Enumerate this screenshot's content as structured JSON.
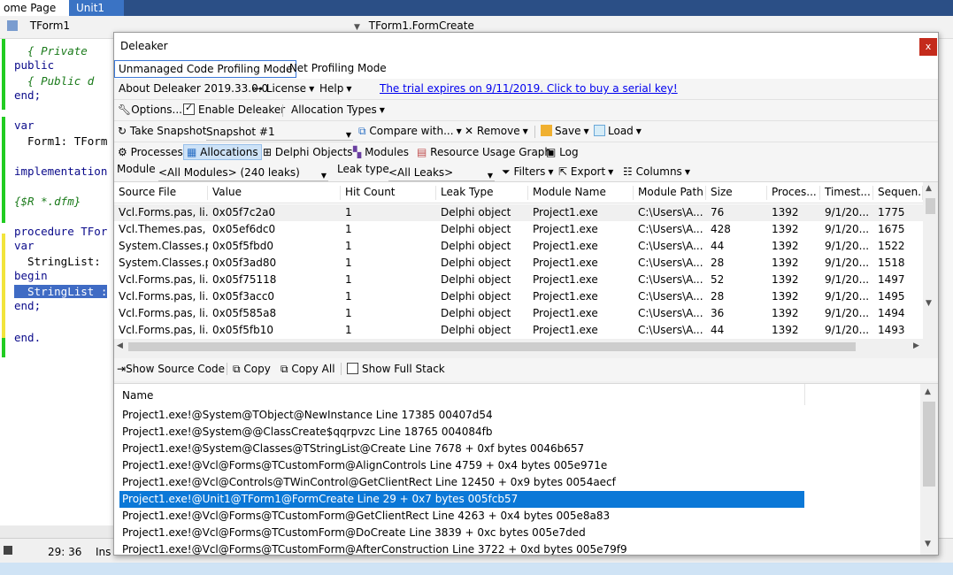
{
  "ide": {
    "tabs": [
      "ome Page",
      "Unit1"
    ],
    "class_combo": "TForm1",
    "method_combo": "TForm1.FormCreate",
    "code_lines": [
      "  { Private",
      "public",
      "  { Public d",
      "end;",
      "",
      "var",
      "  Form1: TForm",
      "",
      "implementation",
      "",
      "{$R *.dfm}",
      "",
      "procedure TFor",
      "var",
      "  StringList:",
      "begin",
      "  StringList :",
      "end;",
      "",
      "end."
    ],
    "status_position": "29: 36",
    "status_mode": "Ins"
  },
  "deleaker": {
    "title": "Deleaker",
    "close_label": "x",
    "modes": [
      "Unmanaged Code Profiling Mode",
      ".Net Profiling Mode"
    ],
    "menu": {
      "about": "About Deleaker 2019.33.0.0",
      "license": "License",
      "help": "Help",
      "trial_link": "The trial expires on 9/11/2019. Click to buy a serial key!"
    },
    "options": {
      "options_label": "Options...",
      "enable_label": "Enable Deleaker",
      "enable_checked": true,
      "allocation_types": "Allocation Types"
    },
    "snapshot_bar": {
      "take_snapshot": "Take Snapshot",
      "snapshot_select": "Snapshot #1",
      "compare": "Compare with...",
      "remove": "Remove",
      "save": "Save",
      "load": "Load"
    },
    "views": [
      "Processes",
      "Allocations",
      "Delphi Objects",
      "Modules",
      "Resource Usage Graph",
      "Log"
    ],
    "active_view": "Allocations",
    "filter_bar": {
      "module_label": "Module",
      "module_value": "<All Modules> (240 leaks)",
      "leak_type_label": "Leak type",
      "leak_type_value": "<All Leaks>",
      "filters": "Filters",
      "export": "Export",
      "columns": "Columns"
    },
    "columns": [
      "Source File",
      "Value",
      "Hit Count",
      "Leak Type",
      "Module Name",
      "Module Path",
      "Size",
      "Proces...",
      "Timest...",
      "Sequen..."
    ],
    "rows": [
      [
        "Vcl.Forms.pas, li...",
        "0x05f7c2a0",
        "1",
        "Delphi object",
        "Project1.exe",
        "C:\\Users\\A...",
        "76",
        "1392",
        "9/1/20...",
        "1775"
      ],
      [
        "Vcl.Themes.pas, l...",
        "0x05ef6dc0",
        "1",
        "Delphi object",
        "Project1.exe",
        "C:\\Users\\A...",
        "428",
        "1392",
        "9/1/20...",
        "1675"
      ],
      [
        "System.Classes.p...",
        "0x05f5fbd0",
        "1",
        "Delphi object",
        "Project1.exe",
        "C:\\Users\\A...",
        "44",
        "1392",
        "9/1/20...",
        "1522"
      ],
      [
        "System.Classes.p...",
        "0x05f3ad80",
        "1",
        "Delphi object",
        "Project1.exe",
        "C:\\Users\\A...",
        "28",
        "1392",
        "9/1/20...",
        "1518"
      ],
      [
        "Vcl.Forms.pas, li...",
        "0x05f75118",
        "1",
        "Delphi object",
        "Project1.exe",
        "C:\\Users\\A...",
        "52",
        "1392",
        "9/1/20...",
        "1497"
      ],
      [
        "Vcl.Forms.pas, li...",
        "0x05f3acc0",
        "1",
        "Delphi object",
        "Project1.exe",
        "C:\\Users\\A...",
        "28",
        "1392",
        "9/1/20...",
        "1495"
      ],
      [
        "Vcl.Forms.pas, li...",
        "0x05f585a8",
        "1",
        "Delphi object",
        "Project1.exe",
        "C:\\Users\\A...",
        "36",
        "1392",
        "9/1/20...",
        "1494"
      ],
      [
        "Vcl.Forms.pas, li...",
        "0x05f5fb10",
        "1",
        "Delphi object",
        "Project1.exe",
        "C:\\Users\\A...",
        "44",
        "1392",
        "9/1/20...",
        "1493"
      ]
    ],
    "stack_toolbar": {
      "show_source": "Show Source Code",
      "copy": "Copy",
      "copy_all": "Copy All",
      "show_full_stack": "Show Full Stack",
      "show_full_stack_checked": false
    },
    "stack_header": "Name",
    "stack_rows": [
      "Project1.exe!@System@TObject@NewInstance Line 17385 00407d54",
      "Project1.exe!@System@@ClassCreate$qqrpvzc Line 18765 004084fb",
      "Project1.exe!@System@Classes@TStringList@Create Line 7678 + 0xf bytes 0046b657",
      "Project1.exe!@Vcl@Forms@TCustomForm@AlignControls Line 4759 + 0x4 bytes 005e971e",
      "Project1.exe!@Vcl@Controls@TWinControl@GetClientRect Line 12450 + 0x9 bytes 0054aecf",
      "Project1.exe!@Unit1@TForm1@FormCreate Line 29 + 0x7 bytes 005fcb57",
      "Project1.exe!@Vcl@Forms@TCustomForm@GetClientRect Line 4263 + 0x4 bytes 005e8a83",
      "Project1.exe!@Vcl@Forms@TCustomForm@DoCreate Line 3839 + 0xc bytes 005e7ded",
      "Project1.exe!@Vcl@Forms@TCustomForm@AfterConstruction Line 3722 + 0xd bytes 005e79f9"
    ],
    "selected_stack_row": 5
  },
  "colors": {
    "selection": "#0b78d7",
    "close_button": "#c42b1c",
    "link": "#0000ee",
    "ide_tab_bar": "#2b4f86"
  }
}
